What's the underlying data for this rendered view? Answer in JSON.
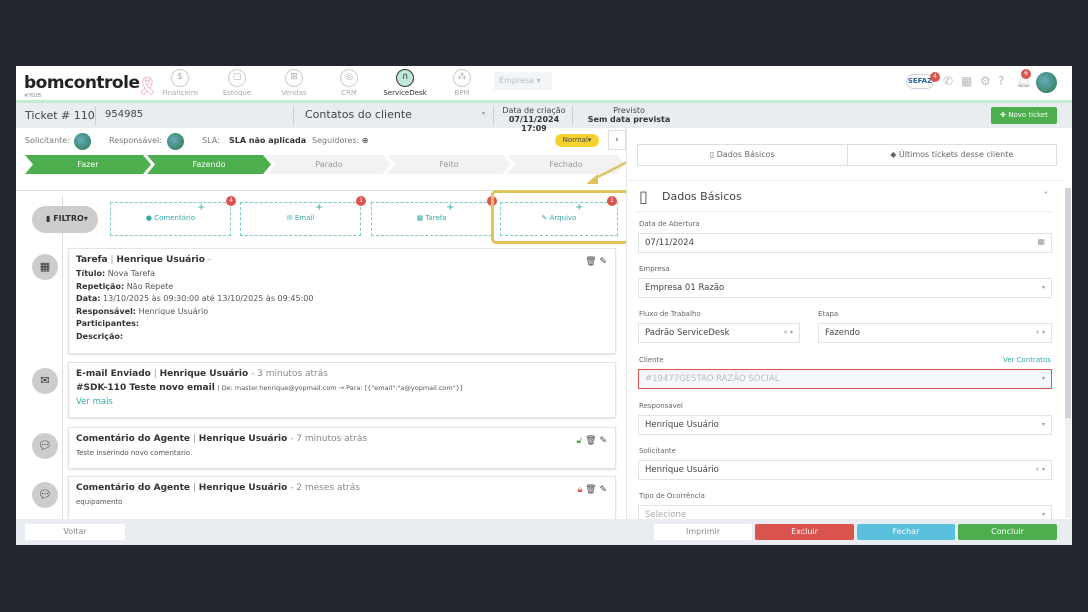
{
  "nav": {
    "logo": "bomcontrole",
    "logo_sub": "#76185",
    "modules": [
      {
        "label": "Financeiro",
        "icon": "dollar-icon"
      },
      {
        "label": "Estoque",
        "icon": "box-icon"
      },
      {
        "label": "Vendas",
        "icon": "cart-icon"
      },
      {
        "label": "CRM",
        "icon": "target-icon"
      },
      {
        "label": "ServiceDesk",
        "icon": "headset-icon",
        "active": true
      },
      {
        "label": "BPM",
        "icon": "network-icon"
      }
    ],
    "empresa_select": "Empresa",
    "sefaz": "SEFAZ",
    "sefaz_badge": "4",
    "notif_badge": "6"
  },
  "header": {
    "ticket": "Ticket # 110",
    "code": "954985",
    "contacts_select": "Contatos do cliente",
    "created_label": "Data de criação",
    "created_value": "07/11/2024 17:09",
    "expected_label": "Previsto",
    "expected_value": "Sem data prevista",
    "new_ticket": "Novo ticket"
  },
  "info": {
    "solicitante": "Solicitante:",
    "responsavel": "Responsável:",
    "sla_label": "SLA:",
    "sla_value": "SLA não aplicada",
    "seguidores": "Seguidores:",
    "priority": "Normal"
  },
  "stages": [
    {
      "label": "Fazer",
      "done": true
    },
    {
      "label": "Fazendo",
      "done": true
    },
    {
      "label": "Parado",
      "done": false
    },
    {
      "label": "Feito",
      "done": false
    },
    {
      "label": "Fechado",
      "done": false
    }
  ],
  "toolbar": {
    "filter": "FILTRO",
    "add_buttons": [
      {
        "label": "Comentário",
        "icon": "comment-icon",
        "badge": "4"
      },
      {
        "label": "Email",
        "icon": "envelope-icon",
        "badge": "1"
      },
      {
        "label": "Tarefa",
        "icon": "calendar-plus-icon",
        "badge": "1"
      },
      {
        "label": "Arquivo",
        "icon": "paperclip-icon",
        "badge": "1"
      }
    ]
  },
  "timeline": {
    "task": {
      "type": "Tarefa",
      "user": "Henrique Usuário",
      "time": "-",
      "fields": [
        {
          "k": "Título:",
          "v": "Nova Tarefa"
        },
        {
          "k": "Repetição:",
          "v": "Não Repete"
        },
        {
          "k": "Data:",
          "v": "13/10/2025 às 09:30:00 até 13/10/2025 às 09:45:00"
        },
        {
          "k": "Responsável:",
          "v": "Henrique Usuário"
        },
        {
          "k": "Participantes:",
          "v": ""
        },
        {
          "k": "Descrição:",
          "v": ""
        }
      ]
    },
    "email": {
      "type": "E-mail Enviado",
      "user": "Henrique Usuário",
      "time": "- 3 minutos atrás",
      "subject": "#SDK-110 Teste novo email",
      "meta": "| De: master.henrique@yopmail.com → Para: [{\"email\":\"a@yopmail.com\"}]",
      "more": "Ver mais"
    },
    "comments": [
      {
        "type": "Comentário do Agente",
        "user": "Henrique Usuário",
        "time": "- 7 minutos atrás",
        "text": "Teste inserindo novo comentario.",
        "locked": false
      },
      {
        "type": "Comentário do Agente",
        "user": "Henrique Usuário",
        "time": "- 2 meses atrás",
        "text": "equipamento",
        "locked": true
      }
    ]
  },
  "right": {
    "tabs": [
      "Dados Básicos",
      "Últimos tickets desse cliente"
    ],
    "section_title": "Dados Básicos",
    "data_abertura_label": "Data de Abertura",
    "data_abertura": "07/11/2024",
    "empresa_label": "Empresa",
    "empresa": "Empresa 01 Razão",
    "fluxo_label": "Fluxo de Trabalho",
    "fluxo": "Padrão ServiceDesk",
    "etapa_label": "Etapa",
    "etapa": "Fazendo",
    "cliente_label": "Cliente",
    "ver_contratos": "Ver Contratos",
    "cliente": "#19477GESTAO RAZÃO SOCIAL",
    "responsavel_label": "Responsável",
    "responsavel": "Henrique Usuário",
    "solicitante_label": "Solicitante",
    "solicitante": "Henrique Usuário",
    "tipo_label": "Tipo de Ocorrência",
    "tipo_placeholder": "Selecione"
  },
  "footer": {
    "voltar": "Voltar",
    "imprimir": "Imprimir",
    "excluir": "Excluir",
    "fechar": "Fechar",
    "concluir": "Concluir"
  },
  "colors": {
    "green": "#4cae4c",
    "red": "#d9534f",
    "blue": "#5bc0de",
    "highlight": "#e0c45a",
    "teal": "#3aa"
  }
}
